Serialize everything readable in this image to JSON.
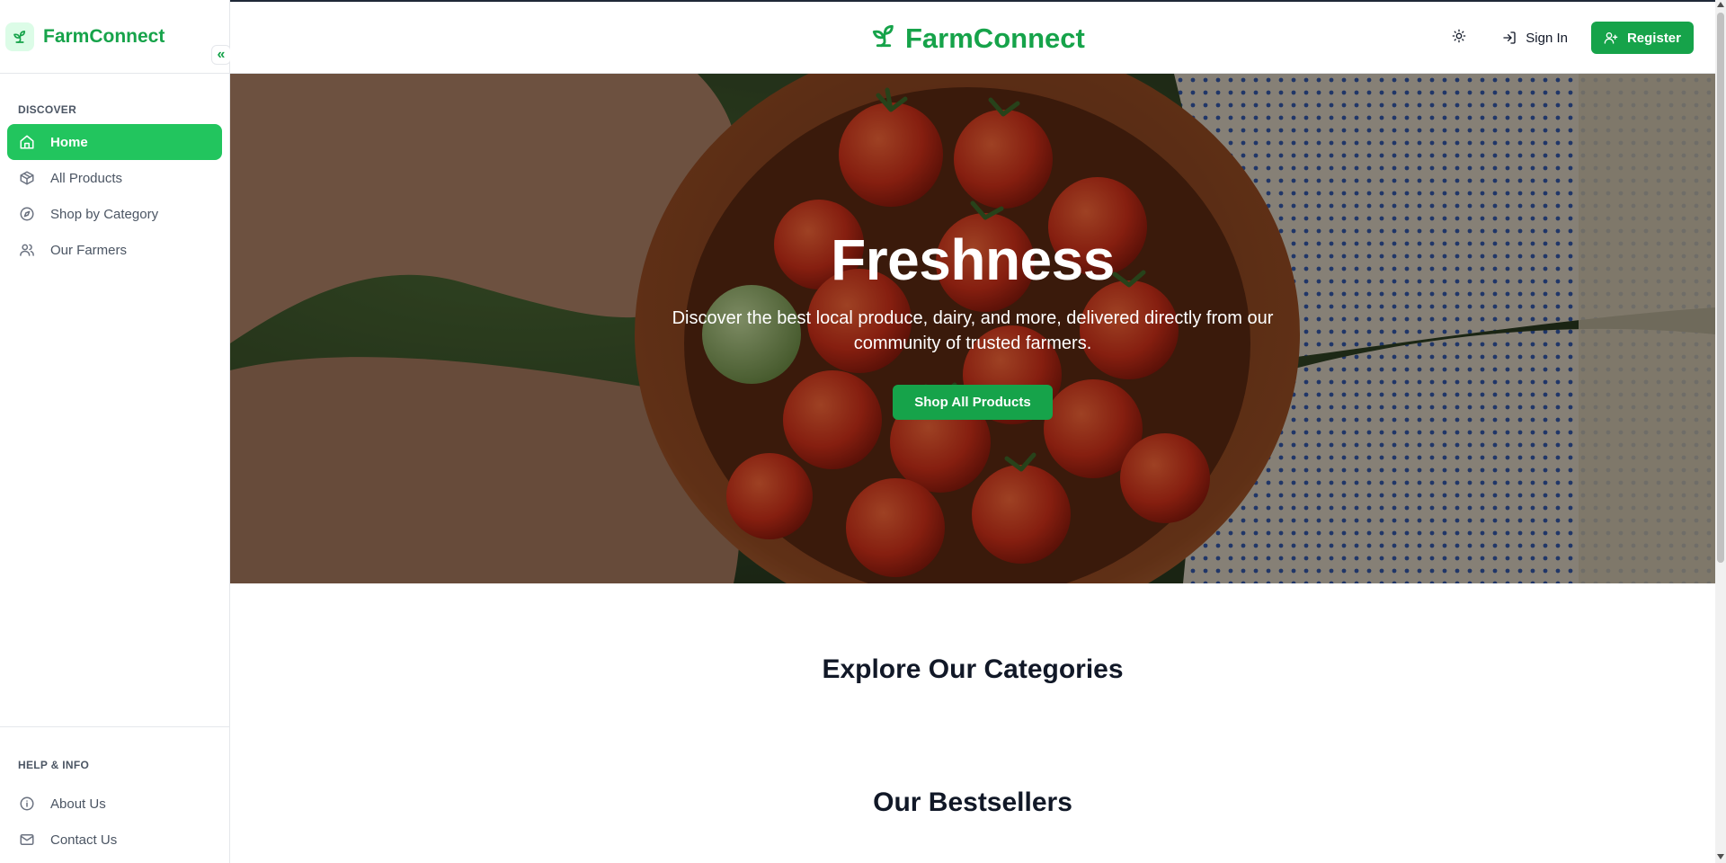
{
  "brand": {
    "name": "FarmConnect"
  },
  "colors": {
    "primary": "#16a34a",
    "primary_light": "#22c55e"
  },
  "sidebar": {
    "discover_title": "DISCOVER",
    "items": [
      {
        "label": "Home",
        "icon": "home-icon",
        "active": true
      },
      {
        "label": "All Products",
        "icon": "package-icon"
      },
      {
        "label": "Shop by Category",
        "icon": "compass-icon"
      },
      {
        "label": "Our Farmers",
        "icon": "users-icon"
      }
    ],
    "help_title": "HELP & INFO",
    "help_items": [
      {
        "label": "About Us",
        "icon": "info-icon"
      },
      {
        "label": "Contact Us",
        "icon": "mail-icon"
      }
    ],
    "collapse_icon": "chevrons-left-icon"
  },
  "header": {
    "theme_icon": "sun-icon",
    "signin_label": "Sign In",
    "register_label": "Register"
  },
  "hero": {
    "title": "Freshness",
    "subtitle": "Discover the best local produce, dairy, and more, delivered directly from our community of trusted farmers.",
    "cta_label": "Shop All Products"
  },
  "sections": {
    "categories_title": "Explore Our Categories",
    "bestsellers_title": "Our Bestsellers"
  }
}
